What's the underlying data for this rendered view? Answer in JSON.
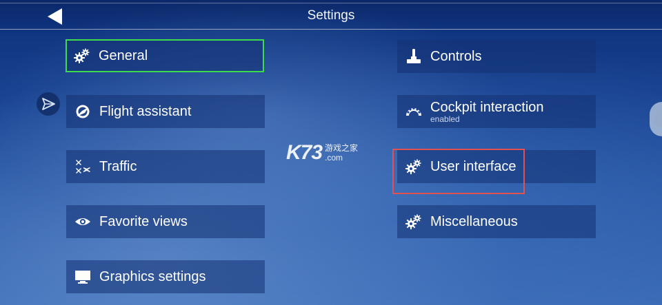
{
  "header": {
    "title": "Settings",
    "back_icon": "back-arrow-icon"
  },
  "menu": {
    "left": [
      {
        "label": "General",
        "icon": "gears-icon",
        "selected": true
      },
      {
        "label": "Flight assistant",
        "icon": "globe-plane-icon"
      },
      {
        "label": "Traffic",
        "icon": "planes-icon"
      },
      {
        "label": "Favorite views",
        "icon": "eye-icon"
      },
      {
        "label": "Graphics settings",
        "icon": "monitor-icon"
      }
    ],
    "right": [
      {
        "label": "Controls",
        "icon": "joystick-icon"
      },
      {
        "label": "Cockpit interaction",
        "sublabel": "enabled",
        "icon": "gauge-icon"
      },
      {
        "label": "User interface",
        "icon": "gears-icon",
        "highlighted": true
      },
      {
        "label": "Miscellaneous",
        "icon": "gears-icon"
      }
    ]
  },
  "side_button": {
    "icon": "paper-plane-icon"
  },
  "watermark": {
    "logo": "K73",
    "text_cn": "游戏之家",
    "text_domain": ".com"
  },
  "colors": {
    "selected_border": "#3ddc4b",
    "focus_border": "#e2504f",
    "item_background": "rgba(20,50,115,0.55)"
  }
}
